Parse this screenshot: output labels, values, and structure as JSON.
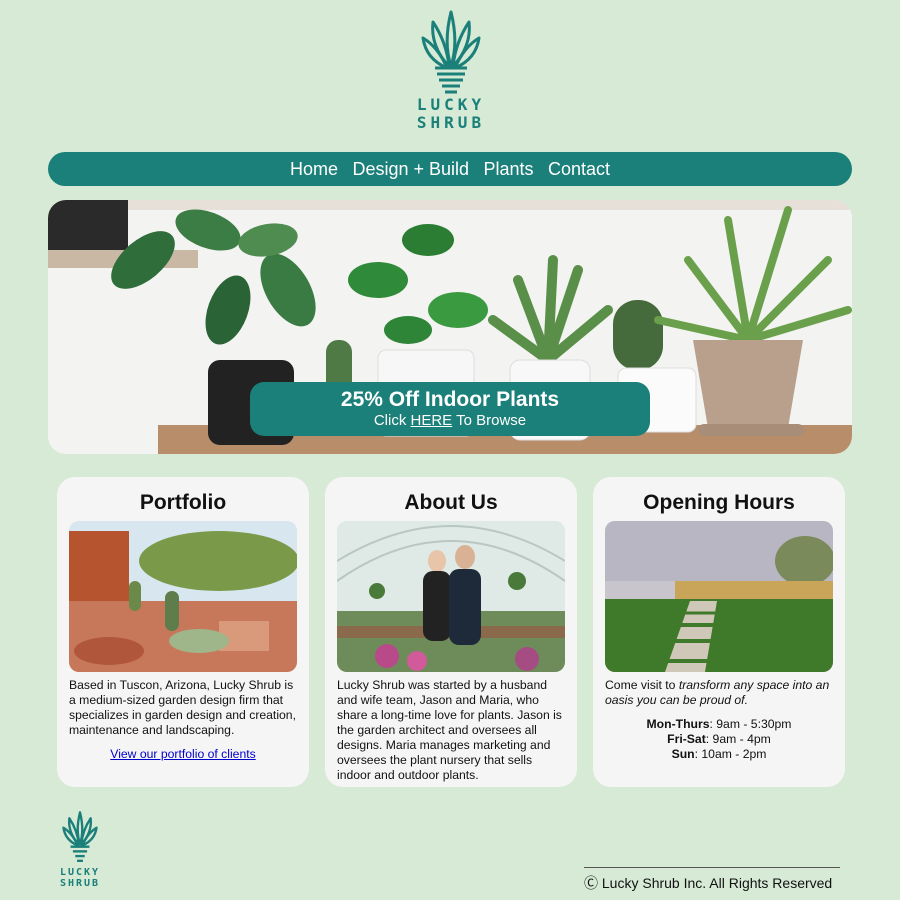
{
  "brand": {
    "name_line1": "LUCKY",
    "name_line2": "SHRUB",
    "color": "#1b7f7a"
  },
  "nav": {
    "items": [
      "Home",
      "Design + Build",
      "Plants",
      "Contact"
    ]
  },
  "promo": {
    "title": "25% Off Indoor Plants",
    "sub_prefix": "Click ",
    "link": "HERE",
    "sub_suffix": " To Browse"
  },
  "cards": {
    "portfolio": {
      "title": "Portfolio",
      "text": "Based in Tuscon, Arizona, Lucky Shrub is a medium-sized garden design firm that specializes in garden design and creation, maintenance and landscaping.",
      "link": "View our portfolio of clients"
    },
    "about": {
      "title": "About Us",
      "text": "Lucky Shrub was started by a husband and wife team, Jason and Maria, who share a long-time love for plants. Jason is the garden architect and oversees all designs. Maria manages marketing and oversees the plant nursery that sells indoor and outdoor plants."
    },
    "hours": {
      "title": "Opening Hours",
      "intro_prefix": "Come visit to ",
      "intro_emph": "transform any space into an oasis you can be proud of.",
      "rows": [
        {
          "day": "Mon-Thurs",
          "time": ": 9am - 5:30pm"
        },
        {
          "day": "Fri-Sat",
          "time": ": 9am - 4pm"
        },
        {
          "day": "Sun",
          "time": ": 10am - 2pm"
        }
      ]
    }
  },
  "footer": {
    "copyright": "Ⓒ Lucky Shrub Inc. All Rights Reserved"
  }
}
